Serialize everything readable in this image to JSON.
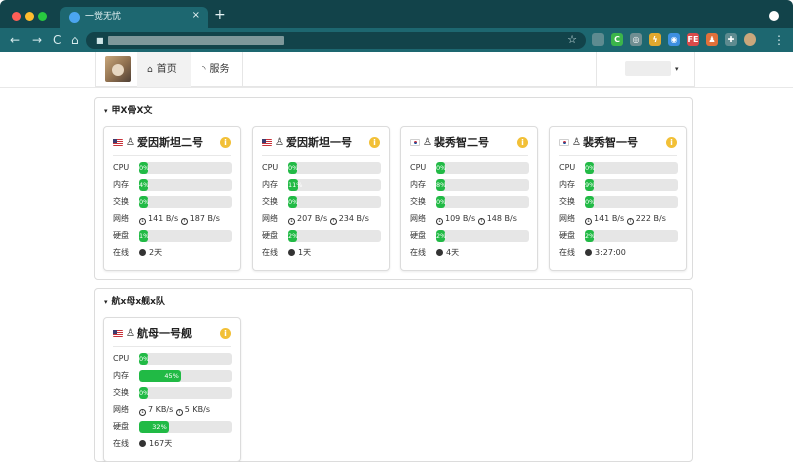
{
  "browser": {
    "tab_title": "一觉无忧",
    "tab_close": "×",
    "new_tab": "+",
    "nav": {
      "back": "←",
      "forward": "→",
      "reload": "C",
      "home": "⌂"
    },
    "star": "☆",
    "kebab": "⋮",
    "extensions": [
      {
        "icon": "shield-extension-icon",
        "glyph": "",
        "color": "#5e8b90"
      },
      {
        "icon": "c-extension-icon",
        "glyph": "C",
        "color": "#3bb54a"
      },
      {
        "icon": "circle-extension-icon",
        "glyph": "◎",
        "color": "#6f8e92"
      },
      {
        "icon": "bolt-extension-icon",
        "glyph": "ϟ",
        "color": "#e0a82e"
      },
      {
        "icon": "compass-extension-icon",
        "glyph": "◉",
        "color": "#3d8fe0"
      },
      {
        "icon": "fe-extension-icon",
        "glyph": "FE",
        "color": "#d94a4a"
      },
      {
        "icon": "figure-extension-icon",
        "glyph": "♟",
        "color": "#e0703a"
      },
      {
        "icon": "puzzle-extension-icon",
        "glyph": "✚",
        "color": "#5e8b90"
      },
      {
        "icon": "profile-avatar-icon",
        "glyph": "",
        "color": "#c9a77c"
      }
    ]
  },
  "nav": {
    "home_icon": "⌂",
    "home_label": "首页",
    "services_icon": "◝",
    "services_label": "服务",
    "user_caret": "▾"
  },
  "groups": [
    {
      "title": "甲X骨X文",
      "caret": "▾",
      "cards": [
        {
          "flag": "us",
          "os_icon": "linux-penguin-icon",
          "os_glyph": "♙",
          "name": "爱因斯坦二号",
          "info": "i",
          "cpu": {
            "label": "CPU",
            "pct": 0,
            "text": "0%"
          },
          "mem": {
            "label": "内存",
            "pct": 4,
            "text": "4%"
          },
          "swap": {
            "label": "交换",
            "pct": 0,
            "text": "0%"
          },
          "net": {
            "label": "网络",
            "down_icon": "↓",
            "down": "141 B/s",
            "up_icon": "↑",
            "up": "187 B/s"
          },
          "disk": {
            "label": "硬盘",
            "pct": 1,
            "text": "1%"
          },
          "uptime": {
            "label": "在线",
            "value": "2天"
          }
        },
        {
          "flag": "us",
          "os_icon": "linux-penguin-icon",
          "os_glyph": "♙",
          "name": "爱因斯坦一号",
          "info": "i",
          "cpu": {
            "label": "CPU",
            "pct": 0,
            "text": "0%"
          },
          "mem": {
            "label": "内存",
            "pct": 11,
            "text": "11%"
          },
          "swap": {
            "label": "交换",
            "pct": 0,
            "text": "0%"
          },
          "net": {
            "label": "网络",
            "down_icon": "↓",
            "down": "207 B/s",
            "up_icon": "↑",
            "up": "234 B/s"
          },
          "disk": {
            "label": "硬盘",
            "pct": 2,
            "text": "2%"
          },
          "uptime": {
            "label": "在线",
            "value": "1天"
          }
        },
        {
          "flag": "kr",
          "os_icon": "linux-penguin-icon",
          "os_glyph": "♙",
          "name": "裴秀智二号",
          "info": "i",
          "cpu": {
            "label": "CPU",
            "pct": 0,
            "text": "0%"
          },
          "mem": {
            "label": "内存",
            "pct": 8,
            "text": "8%"
          },
          "swap": {
            "label": "交换",
            "pct": 0,
            "text": "0%"
          },
          "net": {
            "label": "网络",
            "down_icon": "↓",
            "down": "109 B/s",
            "up_icon": "↑",
            "up": "148 B/s"
          },
          "disk": {
            "label": "硬盘",
            "pct": 2,
            "text": "2%"
          },
          "uptime": {
            "label": "在线",
            "value": "4天"
          }
        },
        {
          "flag": "kr",
          "os_icon": "linux-penguin-icon",
          "os_glyph": "♙",
          "name": "裴秀智一号",
          "info": "i",
          "cpu": {
            "label": "CPU",
            "pct": 0,
            "text": "0%"
          },
          "mem": {
            "label": "内存",
            "pct": 9,
            "text": "9%"
          },
          "swap": {
            "label": "交换",
            "pct": 0,
            "text": "0%"
          },
          "net": {
            "label": "网络",
            "down_icon": "↓",
            "down": "141 B/s",
            "up_icon": "↑",
            "up": "222 B/s"
          },
          "disk": {
            "label": "硬盘",
            "pct": 2,
            "text": "2%"
          },
          "uptime": {
            "label": "在线",
            "value": "3:27:00"
          }
        }
      ]
    },
    {
      "title": "航x母x舰x队",
      "caret": "▾",
      "cards": [
        {
          "flag": "us",
          "os_icon": "linux-penguin-icon",
          "os_glyph": "♙",
          "name": "航母一号舰",
          "info": "i",
          "cpu": {
            "label": "CPU",
            "pct": 0,
            "text": "0%"
          },
          "mem": {
            "label": "内存",
            "pct": 45,
            "text": "45%"
          },
          "swap": {
            "label": "交换",
            "pct": 0,
            "text": "0%"
          },
          "net": {
            "label": "网络",
            "down_icon": "↓",
            "down": "7 KB/s",
            "up_icon": "↑",
            "up": "5 KB/s"
          },
          "disk": {
            "label": "硬盘",
            "pct": 32,
            "text": "32%"
          },
          "uptime": {
            "label": "在线",
            "value": "167天"
          }
        }
      ]
    }
  ],
  "colors": {
    "bar_fill": "#21ba45",
    "bar_track": "#e6e6e6",
    "chrome_dark": "#12434a",
    "chrome_light": "#1d6770",
    "info": "#f2c037"
  }
}
